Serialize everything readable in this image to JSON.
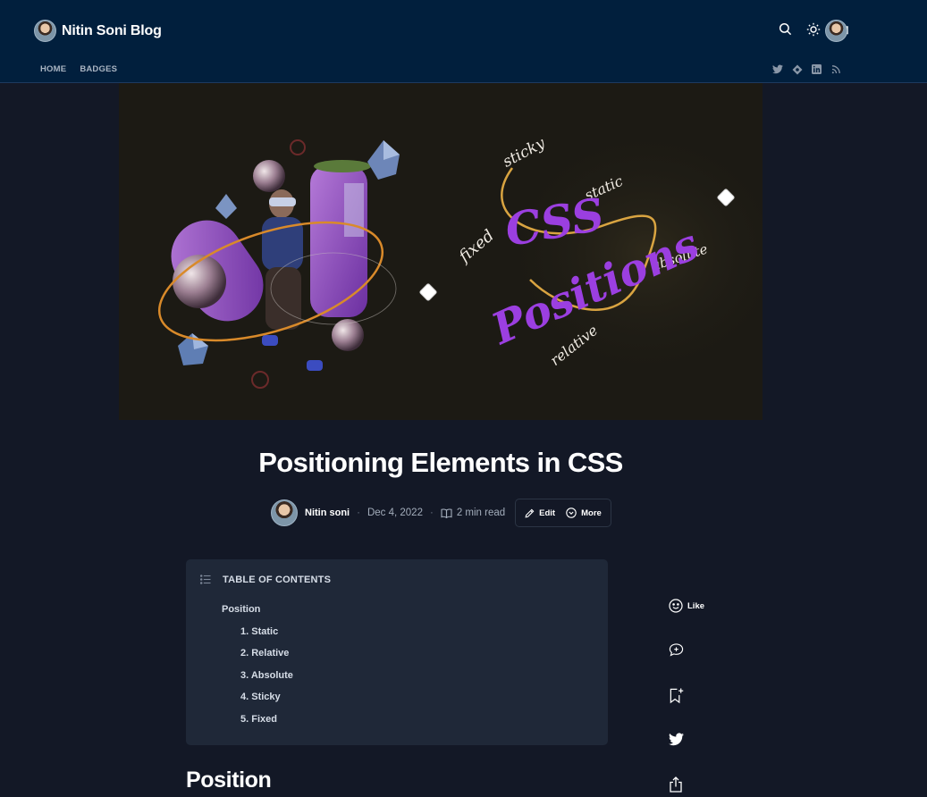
{
  "header": {
    "blog_title": "Nitin Soni Blog",
    "icons": [
      "search-icon",
      "sun-icon",
      "folder-icon"
    ],
    "nav": [
      "HOME",
      "BADGES"
    ],
    "social_icons": [
      "twitter-icon",
      "hashnode-icon",
      "linkedin-icon",
      "rss-icon"
    ]
  },
  "cover": {
    "headline_top": "CSS",
    "headline_bottom": "Positions",
    "words": [
      "sticky",
      "static",
      "fixed",
      "absolute",
      "relative"
    ]
  },
  "post": {
    "title": "Positioning Elements in CSS",
    "author": "Nitin soni",
    "date": "Dec 4, 2022",
    "read_time": "2 min read",
    "edit_label": "Edit",
    "more_label": "More"
  },
  "toc": {
    "heading": "TABLE OF CONTENTS",
    "items": [
      "Position",
      "1. Static",
      "2. Relative",
      "3. Absolute",
      "4. Sticky",
      "5. Fixed"
    ]
  },
  "sidebar": {
    "like_label": "Like"
  },
  "content": {
    "first_heading": "Position"
  },
  "colors": {
    "page_bg": "#131826",
    "header_bg": "#011f3d",
    "toc_bg": "#1f2838",
    "accent_purple": "#9b3fe0",
    "accent_gold": "#d9a441"
  }
}
